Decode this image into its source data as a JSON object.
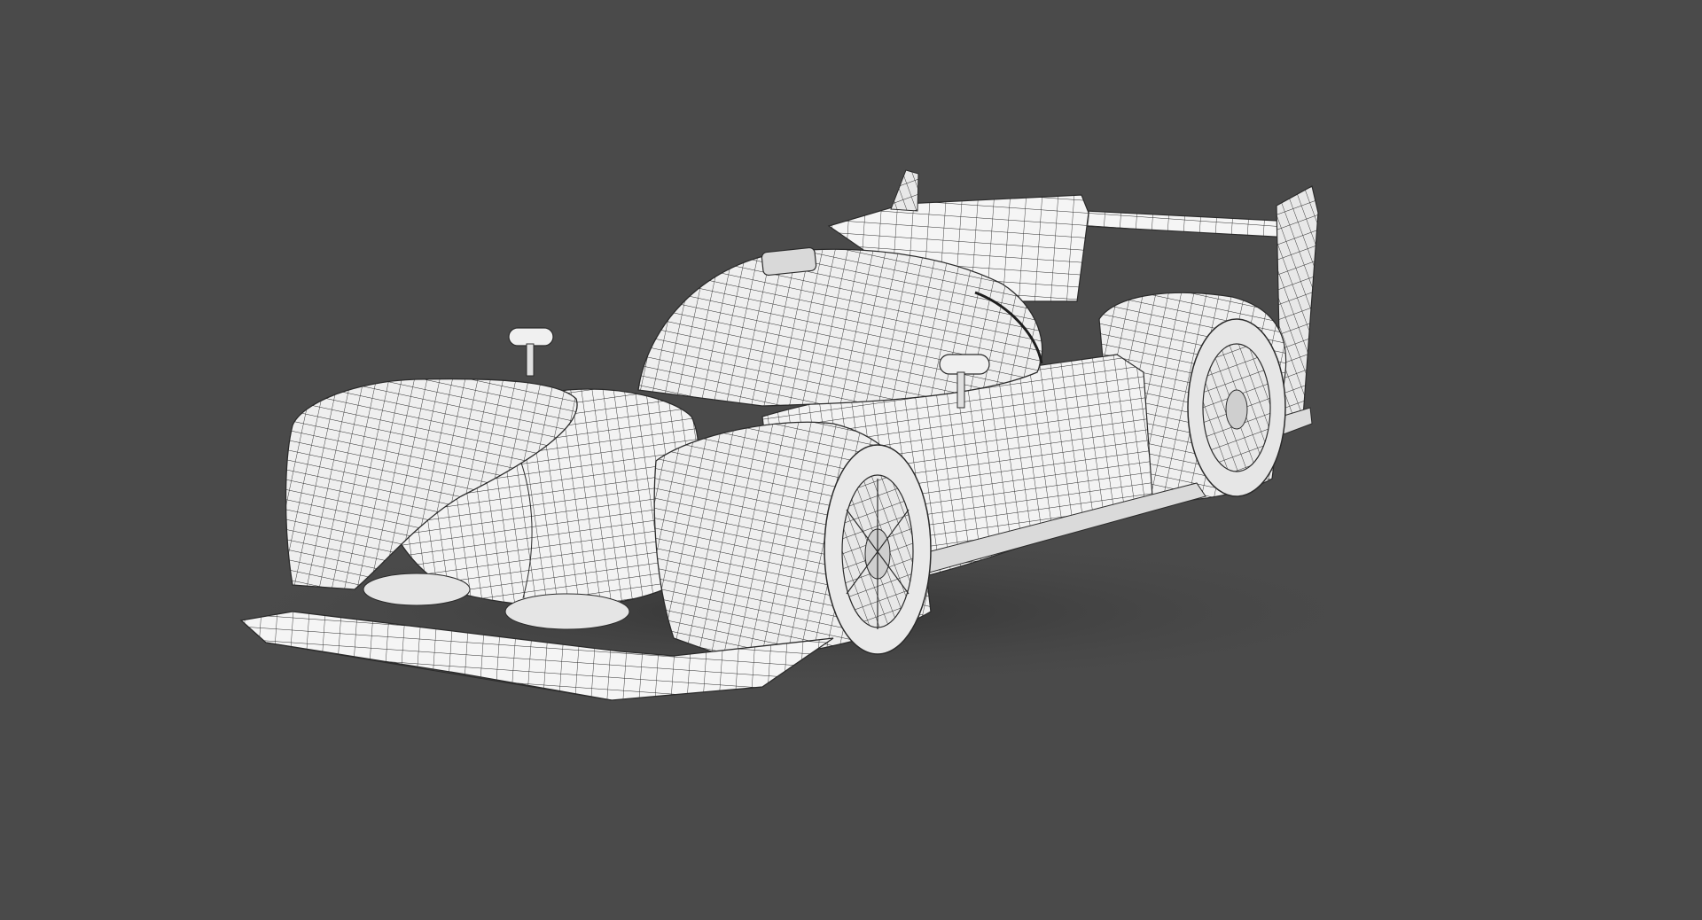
{
  "viewport": {
    "background_color": "#4a4a4a",
    "subject": "race-car-wireframe-model",
    "render_style": "white clay shading with black quad wireframe overlay"
  },
  "colors": {
    "body_fill": "#f2f2f2",
    "body_shadow": "#d4d4d4",
    "wire": "#2a2a2a",
    "ground_shadow": "#3a3a3a",
    "tire": "#e9e9e9",
    "tire_dark": "#bdbdbd"
  }
}
